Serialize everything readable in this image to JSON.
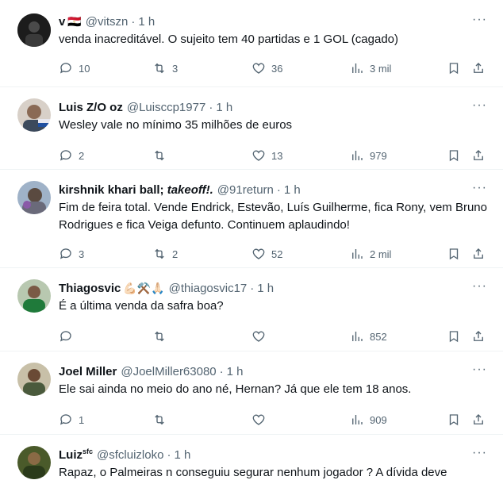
{
  "tweets": [
    {
      "name": "v",
      "flag": "🇪🇬",
      "handle": "@vitszn",
      "time": "1 h",
      "text": "venda inacreditável. O sujeito tem 40 partidas e 1 GOL (cagado)",
      "replies": "10",
      "retweets": "3",
      "likes": "36",
      "views": "3 mil",
      "avatar_color": "#2b2b2b"
    },
    {
      "name": "Luis Z/O oz",
      "handle": "@Luisccp1977",
      "time": "1 h",
      "text": "Wesley vale no mínimo 35 milhões de euros",
      "replies": "2",
      "retweets": "",
      "likes": "13",
      "views": "979",
      "avatar_color": "#6b5a4e"
    },
    {
      "name_main": "kirshnik khari ball; ",
      "name_italic": "takeoff!.",
      "handle": "@91return",
      "time": "1 h",
      "text": "Fim de feira total. Vende Endrick, Estevão, Luís Guilherme, fica Rony, vem Bruno Rodrigues e fica Veiga defunto. Continuem aplaudindo!",
      "replies": "3",
      "retweets": "2",
      "likes": "52",
      "views": "2 mil",
      "avatar_color": "#7a8fa6"
    },
    {
      "name": "Thiagosvic",
      "emojis": "💪🏻⚒️🙏🏻",
      "handle": "@thiagosvic17",
      "time": "1 h",
      "text": "É a última venda da safra boa?",
      "replies": "",
      "retweets": "",
      "likes": "",
      "views": "852",
      "avatar_color": "#2e6b3a"
    },
    {
      "name": "Joel Miller",
      "handle": "@JoelMiller63080",
      "time": "1 h",
      "text": "Ele sai ainda no meio do ano né, Hernan? Já que ele tem 18 anos.",
      "replies": "1",
      "retweets": "",
      "likes": "",
      "views": "909",
      "avatar_color": "#4a5a3c"
    },
    {
      "name": "Luiz",
      "name_sup": "sfc",
      "handle": "@sfcluizloko",
      "time": "1 h",
      "text": "Rapaz, o Palmeiras n conseguiu segurar nenhum jogador ? A dívida deve",
      "avatar_color": "#3a4a2a"
    }
  ],
  "ui": {
    "more_glyph": "···",
    "dot": "·",
    "text_color": "#0f1419",
    "muted_color": "#536471",
    "divider_color": "#eff3f4"
  }
}
